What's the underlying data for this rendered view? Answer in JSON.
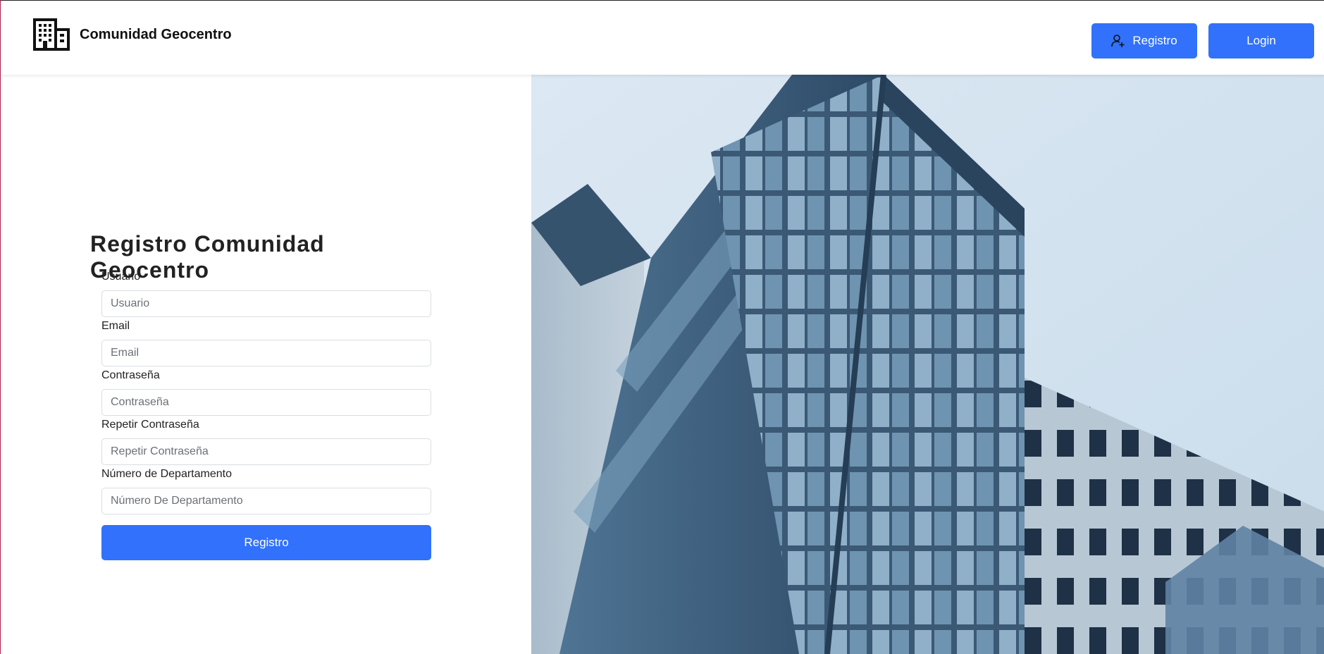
{
  "header": {
    "brand_name": "Comunidad Geocentro",
    "register_button": "Registro",
    "login_button": "Login"
  },
  "form": {
    "title": "Registro Comunidad Geocentro",
    "fields": [
      {
        "label": "Usuario",
        "placeholder": "Usuario"
      },
      {
        "label": "Email",
        "placeholder": "Email"
      },
      {
        "label": "Contraseña",
        "placeholder": "Contraseña"
      },
      {
        "label": "Repetir Contraseña",
        "placeholder": "Repetir Contraseña"
      },
      {
        "label": "Número de Departamento",
        "placeholder": "Número De Departamento"
      }
    ],
    "submit_label": "Registro"
  },
  "colors": {
    "accent": "#3171fb",
    "sky": "#dce8f2",
    "building": "#3d5a78"
  },
  "icons": {
    "brand": "building-icon",
    "register": "user-plus-icon"
  }
}
